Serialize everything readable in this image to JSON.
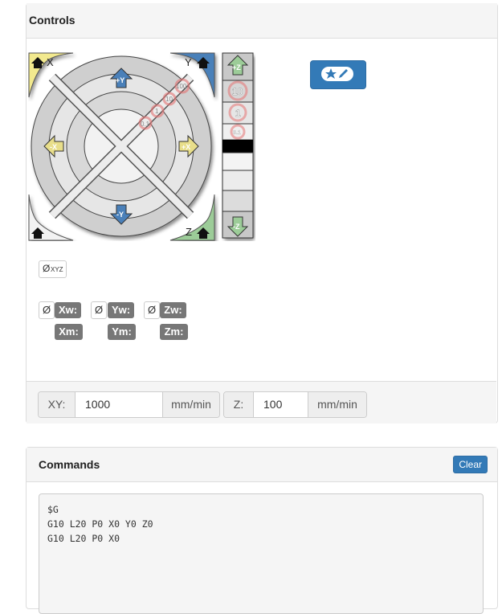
{
  "controls": {
    "title": "Controls",
    "jog": {
      "corner_x": "X",
      "corner_y": "Y",
      "corner_z": "Z",
      "plus_y": "+Y",
      "minus_y": "-Y",
      "plus_x": "+X",
      "minus_x": "-X",
      "step_labels": [
        "0.1",
        "1",
        "10",
        "100"
      ]
    },
    "zbar": {
      "plus_z": "+Z",
      "minus_z": "-Z",
      "steps": [
        "10",
        "1",
        "0.1"
      ]
    },
    "zero_all": {
      "symbol": "Ø",
      "label": "XYZ"
    },
    "axes": [
      {
        "zero": "Ø",
        "work": "Xw:",
        "machine": "Xm:"
      },
      {
        "zero": "Ø",
        "work": "Yw:",
        "machine": "Ym:"
      },
      {
        "zero": "Ø",
        "work": "Zw:",
        "machine": "Zm:"
      }
    ],
    "feed": {
      "xy_label": "XY:",
      "xy_value": "1000",
      "xy_unit": "mm/min",
      "z_label": "Z:",
      "z_value": "100",
      "z_unit": "mm/min"
    }
  },
  "commands": {
    "title": "Commands",
    "clear_label": "Clear",
    "lines": [
      "$G",
      "G10 L20 P0 X0 Y0 Z0",
      "G10 L20 P0 X0"
    ]
  },
  "colors": {
    "primary": "#337ab7",
    "x_axis": "#f2e98e",
    "y_axis": "#4a80b9",
    "z_axis": "#9ccc98"
  },
  "icons": [
    "home-icon",
    "star-icon",
    "pencil-icon",
    "arrow-up-icon",
    "arrow-down-icon",
    "arrow-left-icon",
    "arrow-right-icon"
  ]
}
